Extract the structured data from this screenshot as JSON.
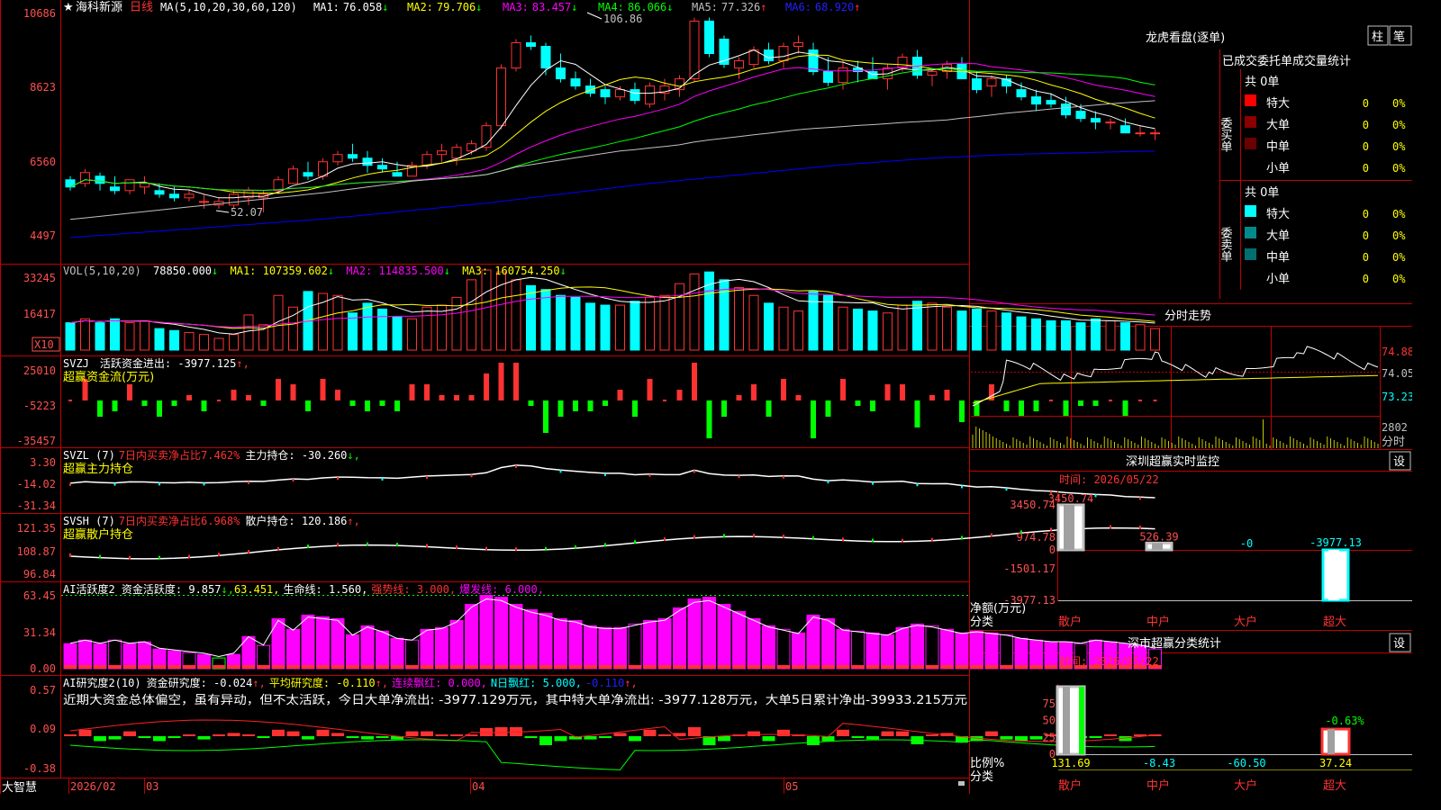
{
  "colors": {
    "up": "#ff3232",
    "down": "#00ffff",
    "ma1": "#ffffff",
    "ma2": "#ffff00",
    "ma3": "#ff00ff",
    "ma4": "#00ff00",
    "ma5": "#c0c0c0",
    "ma6": "#0000ff",
    "frame": "#c00000",
    "axis": "#ff5050",
    "white": "#ffffff"
  },
  "price": {
    "star": "★",
    "name": "海科新源",
    "period": "日线",
    "ma_label": "MA(5,10,20,30,60,120)",
    "ma_values": [
      {
        "k": "MA1:",
        "v": "76.058",
        "a": "↓"
      },
      {
        "k": "MA2:",
        "v": "79.706",
        "a": "↓"
      },
      {
        "k": "MA3:",
        "v": "83.457",
        "a": "↓"
      },
      {
        "k": "MA4:",
        "v": "86.066",
        "a": "↓"
      },
      {
        "k": "MA5:",
        "v": "77.326",
        "a": "↑"
      },
      {
        "k": "MA6:",
        "v": "68.920",
        "a": "↑"
      }
    ],
    "y_ticks": [
      "10686",
      "8623",
      "6560",
      "4497"
    ],
    "high_mark": "106.86",
    "low_mark": "52.07"
  },
  "vol": {
    "label": "VOL(5,10,20)",
    "v": "78850.000",
    "a": "↓",
    "ma1": "MA1: 107359.602",
    "ma1a": "↓",
    "ma2": "MA2: 114835.500",
    "ma2a": "↓",
    "ma3": "MA3: 160754.250",
    "ma3a": "↓",
    "y_ticks": [
      "33245",
      "16417"
    ],
    "unit": "X10"
  },
  "svzj": {
    "l1a": "SVZJ",
    "l1b": "活跃资金进出: -3977.125",
    "l1c": "↑,",
    "l2": "超赢资金流(万元)",
    "y_ticks": [
      "25010",
      "-5223",
      "-35457"
    ]
  },
  "svzl": {
    "l1a": "SVZL (7)",
    "l1b": "7日内买卖净占比7.462%",
    "l1c": "主力持仓: -30.260",
    "l1d": "↓,",
    "l2": "超赢主力持仓",
    "y_ticks": [
      "3.30",
      "-14.02",
      "-31.34"
    ]
  },
  "svsh": {
    "l1a": "SVSH (7)",
    "l1b": "7日内买卖净占比6.968%",
    "l1c": "散户持仓: 120.186",
    "l1d": "↑,",
    "l2": "超赢散户持仓",
    "y_ticks": [
      "121.35",
      "108.87",
      "96.84"
    ]
  },
  "ai2": {
    "l1a": "AI活跃度2 资金活跃度: 9.857",
    "l1b": "↓,",
    "l1c": "63.451,",
    "l1d": "生命线: 1.560,",
    "l1e": "强势线: 3.000,",
    "l1f": "爆发线: 6.000,",
    "y_ticks": [
      "63.45",
      "31.34",
      "0.00"
    ]
  },
  "ai_study": {
    "l1a": "AI研究度2(10)",
    "l1b": "资金研究度: -0.024",
    "l1c": "↑,",
    "l1d": "平均研究度: -0.110",
    "l1e": "↑,",
    "l1f": "连续飘红: 0.000,",
    "l1g": "N日飘红: 5.000,",
    "l1h": "-0.110",
    "l1i": "↑,",
    "note": "近期大资金总体偏空，虽有异动，但不太活跃，今日大单净流出: -3977.129万元，其中特大单净流出: -3977.128万元，大单5日累计净出-39933.215万元",
    "y_ticks": [
      "0.57",
      "0.09",
      "-0.38"
    ]
  },
  "xaxis": {
    "app": "大智慧",
    "labels": [
      "2026/02",
      "03",
      "04",
      "05"
    ]
  },
  "lhb": {
    "title": "龙虎看盘(逐单)",
    "btn1": "柱",
    "btn2": "笔",
    "subtitle": "已成交委托单成交量统计",
    "buy": {
      "side": "委买单",
      "count": "共 0单",
      "rows": [
        {
          "name": "特大",
          "v": "0",
          "p": "0%",
          "c": "#ff0000"
        },
        {
          "name": "大单",
          "v": "0",
          "p": "0%",
          "c": "#8b0000"
        },
        {
          "name": "中单",
          "v": "0",
          "p": "0%",
          "c": "#6b0000"
        },
        {
          "name": "小单",
          "v": "0",
          "p": "0%",
          "c": "#000000"
        }
      ]
    },
    "sell": {
      "side": "委卖单",
      "count": "共 0单",
      "rows": [
        {
          "name": "特大",
          "v": "0",
          "p": "0%",
          "c": "#00ffff"
        },
        {
          "name": "大单",
          "v": "0",
          "p": "0%",
          "c": "#008b8b"
        },
        {
          "name": "中单",
          "v": "0",
          "p": "0%",
          "c": "#006f6f"
        },
        {
          "name": "小单",
          "v": "0",
          "p": "0%",
          "c": "#000000"
        }
      ]
    }
  },
  "intraday": {
    "title": "分时走势",
    "y1": "74.88",
    "y2": "74.05",
    "y3": "73.23",
    "vol": "2802",
    "unit": "分时"
  },
  "monitor": {
    "title": "深圳超赢实时监控",
    "btn": "设",
    "time": "时间: 2026/05/22",
    "y": [
      "3450.74",
      "974.78",
      "0",
      "-1501.17",
      "-3977.13"
    ],
    "ylabel": "净额(万元)",
    "xlabel": "分类",
    "cats": [
      {
        "name": "散户",
        "value": 3450.74,
        "label": "3450.74"
      },
      {
        "name": "中户",
        "value": 526.39,
        "label": "526.39"
      },
      {
        "name": "大户",
        "value": 0,
        "label": "-0"
      },
      {
        "name": "超大",
        "value": -3977.13,
        "label": "-3977.13"
      }
    ]
  },
  "classify": {
    "title": "深市超赢分类统计",
    "btn": "设",
    "time": "时间: 2026/05/22",
    "y": [
      "75",
      "50",
      "25",
      "0"
    ],
    "ylabel": "比例%",
    "xlabel": "分类",
    "cats": [
      {
        "name": "散户",
        "value": 131.69,
        "label": "131.69"
      },
      {
        "name": "中户",
        "value": -8.43,
        "label": "-8.43"
      },
      {
        "name": "大户",
        "value": -60.5,
        "label": "-60.50"
      },
      {
        "name": "超大",
        "value": 37.24,
        "label": "37.24"
      }
    ],
    "extra": "-0.63%"
  },
  "chart_data": [
    {
      "type": "candlestick",
      "title": "海科新源 日线",
      "ylim": [
        44.97,
        106.86
      ],
      "ohlc": [
        [
          61,
          62,
          58,
          59
        ],
        [
          60,
          64,
          59,
          63
        ],
        [
          62,
          63,
          58,
          60
        ],
        [
          59,
          62,
          57,
          58
        ],
        [
          58,
          61,
          57,
          61
        ],
        [
          59,
          62,
          57,
          60
        ],
        [
          58,
          60,
          56,
          57
        ],
        [
          57,
          59,
          55,
          56
        ],
        [
          56,
          58,
          55,
          57
        ],
        [
          55,
          57,
          53,
          55
        ],
        [
          54,
          56,
          53,
          55
        ],
        [
          54,
          58,
          53,
          57
        ],
        [
          56,
          59,
          54,
          58
        ],
        [
          56,
          58,
          52,
          57
        ],
        [
          58,
          62,
          57,
          61
        ],
        [
          60,
          65,
          60,
          64
        ],
        [
          63,
          66,
          61,
          62
        ],
        [
          62,
          67,
          61,
          66
        ],
        [
          66,
          69,
          65,
          68
        ],
        [
          68,
          71,
          66,
          67
        ],
        [
          67,
          69,
          63,
          65
        ],
        [
          65,
          67,
          63,
          64
        ],
        [
          63,
          66,
          62,
          62
        ],
        [
          62,
          66,
          62,
          65
        ],
        [
          65,
          69,
          64,
          68
        ],
        [
          68,
          71,
          66,
          69
        ],
        [
          67,
          71,
          65,
          70
        ],
        [
          69,
          72,
          68,
          71
        ],
        [
          70,
          77,
          69,
          76
        ],
        [
          76,
          93,
          75,
          92
        ],
        [
          92,
          100,
          91,
          99
        ],
        [
          99,
          101,
          97,
          98
        ],
        [
          98,
          99,
          90,
          92
        ],
        [
          92,
          96,
          88,
          89
        ],
        [
          89,
          91,
          86,
          87
        ],
        [
          87,
          89,
          84,
          85
        ],
        [
          86,
          87,
          82,
          84
        ],
        [
          84,
          87,
          83,
          86
        ],
        [
          86,
          88,
          82,
          83
        ],
        [
          82,
          88,
          81,
          87
        ],
        [
          85,
          89,
          83,
          87
        ],
        [
          86,
          90,
          84,
          89
        ],
        [
          89,
          106,
          88,
          105
        ],
        [
          105,
          106,
          95,
          96
        ],
        [
          100,
          101,
          92,
          93
        ],
        [
          92,
          95,
          89,
          94
        ],
        [
          93,
          98,
          92,
          97
        ],
        [
          97,
          99,
          93,
          94
        ],
        [
          94,
          99,
          92,
          98
        ],
        [
          98,
          101,
          96,
          99
        ],
        [
          97,
          99,
          90,
          91
        ],
        [
          91,
          95,
          87,
          88
        ],
        [
          88,
          94,
          86,
          92
        ],
        [
          92,
          94,
          88,
          91
        ],
        [
          91,
          95,
          89,
          89
        ],
        [
          89,
          93,
          86,
          92
        ],
        [
          92,
          96,
          91,
          95
        ],
        [
          95,
          97,
          89,
          90
        ],
        [
          90,
          92,
          87,
          91
        ],
        [
          91,
          94,
          89,
          93
        ],
        [
          93,
          95,
          90,
          89
        ],
        [
          89,
          91,
          85,
          86
        ],
        [
          87,
          90,
          84,
          89
        ],
        [
          89,
          90,
          85,
          87
        ],
        [
          86,
          88,
          83,
          84
        ],
        [
          84,
          86,
          80,
          82
        ],
        [
          83,
          85,
          81,
          82
        ],
        [
          82,
          84,
          78,
          79
        ],
        [
          80,
          82,
          77,
          78
        ],
        [
          78,
          80,
          75,
          77
        ],
        [
          77,
          78,
          75,
          77
        ],
        [
          76,
          78,
          74,
          74
        ],
        [
          74,
          76,
          73,
          74
        ],
        [
          74,
          75,
          72,
          74
        ]
      ],
      "ma5": [
        61,
        61,
        60,
        60,
        59,
        59,
        58,
        58,
        57,
        57,
        56,
        56,
        56,
        56,
        57,
        59,
        60,
        62,
        64,
        65,
        66,
        66,
        65,
        65,
        65,
        66,
        67,
        68,
        70,
        76,
        82,
        88,
        94,
        96,
        95,
        91,
        88,
        86,
        85,
        85,
        85,
        86,
        90,
        92,
        94,
        96,
        97,
        96,
        96,
        97,
        96,
        94,
        92,
        90,
        90,
        90,
        91,
        91,
        91,
        91,
        91,
        90,
        89,
        88,
        87,
        85,
        84,
        83,
        81,
        79,
        78,
        77,
        76,
        76
      ],
      "ma6": [
        45,
        45.3,
        45.6,
        45.9,
        46.2,
        46.5,
        46.8,
        47.1,
        47.4,
        47.7,
        48,
        48.3,
        48.6,
        48.9,
        49.2,
        49.5,
        49.8,
        50.1,
        50.5,
        50.9,
        51.3,
        51.7,
        52.1,
        52.5,
        52.9,
        53.3,
        53.7,
        54.1,
        54.5,
        55,
        55.5,
        56,
        56.5,
        57,
        57.5,
        58,
        58.5,
        59,
        59.5,
        60,
        60.4,
        60.8,
        61.2,
        61.6,
        62,
        62.4,
        62.8,
        63.2,
        63.6,
        64,
        64.4,
        64.8,
        65.2,
        65.5,
        65.8,
        66.1,
        66.4,
        66.7,
        67,
        67.2,
        67.4,
        67.6,
        67.8,
        68,
        68.1,
        68.2,
        68.3,
        68.4,
        68.5,
        68.6,
        68.7,
        68.8,
        68.9,
        68.92
      ]
    },
    {
      "type": "bar",
      "title": "VOL",
      "ylim": [
        0,
        41000
      ],
      "values": [
        14000,
        16000,
        14000,
        16000,
        14000,
        15000,
        11000,
        10000,
        9000,
        8000,
        6000,
        8000,
        18000,
        13000,
        28000,
        22000,
        30000,
        29000,
        28000,
        19000,
        24000,
        21000,
        17000,
        16000,
        22000,
        23000,
        27000,
        36000,
        41000,
        40000,
        36000,
        33000,
        31000,
        28000,
        27000,
        24000,
        23000,
        23000,
        25000,
        27000,
        28000,
        34000,
        39000,
        40000,
        36000,
        32000,
        28000,
        24000,
        22000,
        20000,
        30000,
        28000,
        22000,
        21000,
        20000,
        19000,
        23000,
        25000,
        24000,
        22000,
        20000,
        21000,
        20000,
        19000,
        17000,
        16000,
        15000,
        15000,
        14000,
        16000,
        15000,
        14000,
        13000,
        11000
      ]
    }
  ]
}
